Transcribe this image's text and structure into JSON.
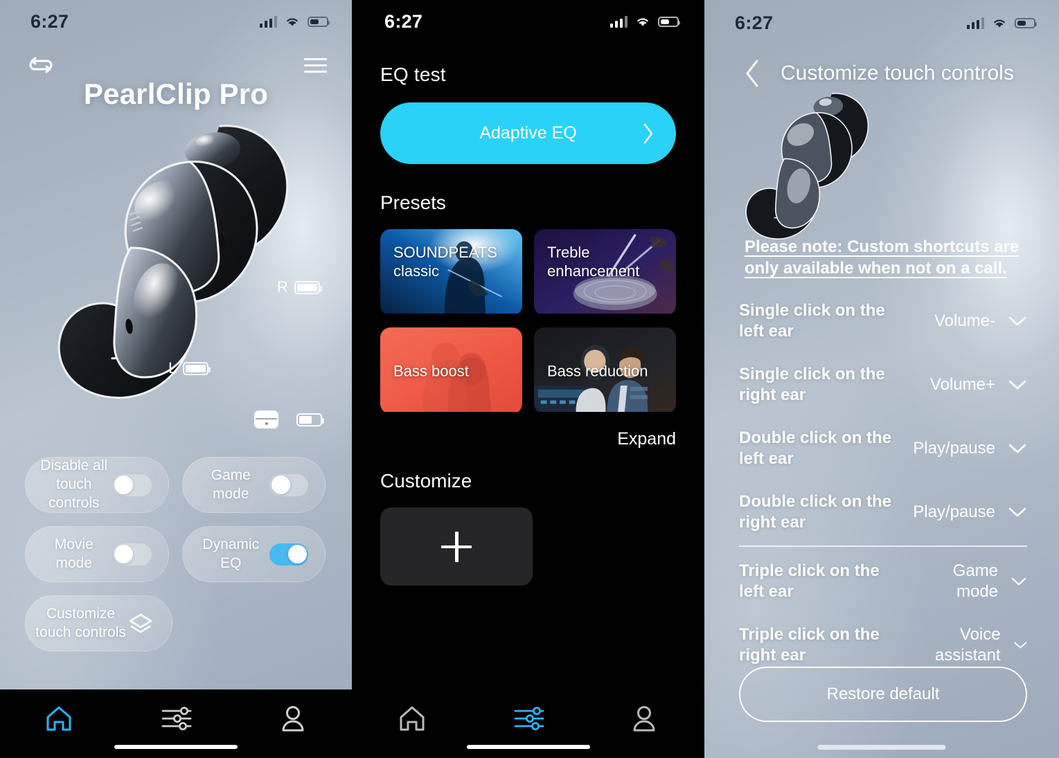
{
  "status_bar": {
    "time": "6:27",
    "signal_icon": "cellular-signal-icon",
    "wifi_icon": "wifi-icon",
    "battery_icon": "battery-icon"
  },
  "home_screen": {
    "swap_icon": "swap-device-icon",
    "menu_icon": "hamburger-menu-icon",
    "device_title": "PearlClip Pro",
    "battery_right": {
      "label": "R",
      "level": 100
    },
    "battery_left": {
      "label": "L",
      "level": 100
    },
    "battery_case": {
      "label": "case-icon",
      "level": 62
    },
    "cards": [
      {
        "label": "Disable all touch controls",
        "type": "toggle",
        "on": false,
        "name": "disable-all-touch-controls"
      },
      {
        "label": "Game mode",
        "type": "toggle",
        "on": false,
        "name": "game-mode"
      },
      {
        "label": "Movie mode",
        "type": "toggle",
        "on": false,
        "name": "movie-mode"
      },
      {
        "label": "Dynamic EQ",
        "type": "toggle",
        "on": true,
        "name": "dynamic-eq"
      },
      {
        "label": "Customize touch controls",
        "type": "link",
        "icon": "layers-icon",
        "name": "customize-touch-controls"
      }
    ],
    "nav": [
      {
        "icon": "home-icon",
        "active": true
      },
      {
        "icon": "equalizer-sliders-icon",
        "active": false
      },
      {
        "icon": "person-profile-icon",
        "active": false
      }
    ]
  },
  "eq_screen": {
    "eq_test_heading": "EQ test",
    "adaptive_eq_label": "Adaptive EQ",
    "adaptive_eq_chevron": "chevron-right-icon",
    "adaptive_eq_color": "#2ad2f7",
    "presets_heading": "Presets",
    "presets": [
      {
        "label": "SOUNDPEATS classic",
        "name": "preset-soundpeats-classic"
      },
      {
        "label": "Treble enhancement",
        "name": "preset-treble-enhancement"
      },
      {
        "label": "Bass boost",
        "name": "preset-bass-boost"
      },
      {
        "label": "Bass reduction",
        "name": "preset-bass-reduction"
      }
    ],
    "expand_label": "Expand",
    "customize_heading": "Customize",
    "add_icon": "plus-icon",
    "nav": [
      {
        "icon": "home-icon",
        "active": false
      },
      {
        "icon": "equalizer-sliders-icon",
        "active": true
      },
      {
        "icon": "person-profile-icon",
        "active": false
      }
    ]
  },
  "touch_screen": {
    "back_icon": "back-chevron-icon",
    "title": "Customize touch controls",
    "note": "Please note: Custom shortcuts are only available when not on a call.",
    "rows": [
      {
        "gesture": "Single click on the left ear",
        "action": "Volume-",
        "chevron": "chevron-down-icon"
      },
      {
        "gesture": "Single click on the right ear",
        "action": "Volume+",
        "chevron": "chevron-down-icon"
      },
      {
        "gesture": "Double click on the left ear",
        "action": "Play/pause",
        "chevron": "chevron-down-icon"
      },
      {
        "gesture": "Double click on the right ear",
        "action": "Play/pause",
        "chevron": "chevron-down-icon"
      },
      {
        "gesture": "Triple click on the left ear",
        "action": "Game mode",
        "chevron": "chevron-down-icon"
      },
      {
        "gesture": "Triple click on the right ear",
        "action": "Voice assistant",
        "chevron": "chevron-down-icon"
      }
    ],
    "restore_label": "Restore default"
  }
}
